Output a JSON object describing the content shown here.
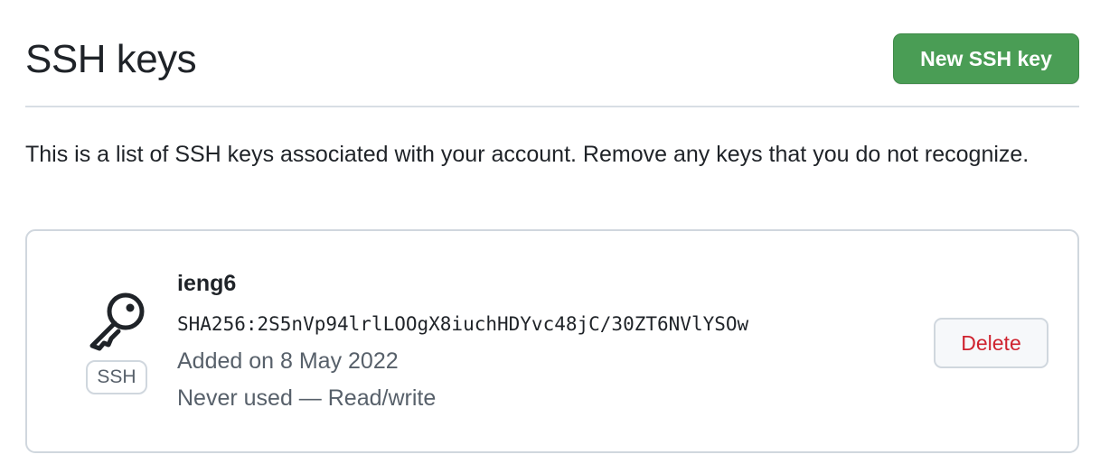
{
  "header": {
    "title": "SSH keys",
    "new_key_label": "New SSH key"
  },
  "description": "This is a list of SSH keys associated with your account. Remove any keys that you do not recognize.",
  "keys": [
    {
      "icon": "key-icon",
      "badge": "SSH",
      "title": "ieng6",
      "fingerprint": "SHA256:2S5nVp94lrlLOOgX8iuchHDYvc48jC/30ZT6NVlYSOw",
      "added": "Added on 8 May 2022",
      "usage": "Never used — Read/write",
      "delete_label": "Delete"
    }
  ],
  "colors": {
    "primary_button": "#4a9d55",
    "danger_text": "#cf222e",
    "muted_text": "#57606a",
    "border": "#d0d7de"
  }
}
